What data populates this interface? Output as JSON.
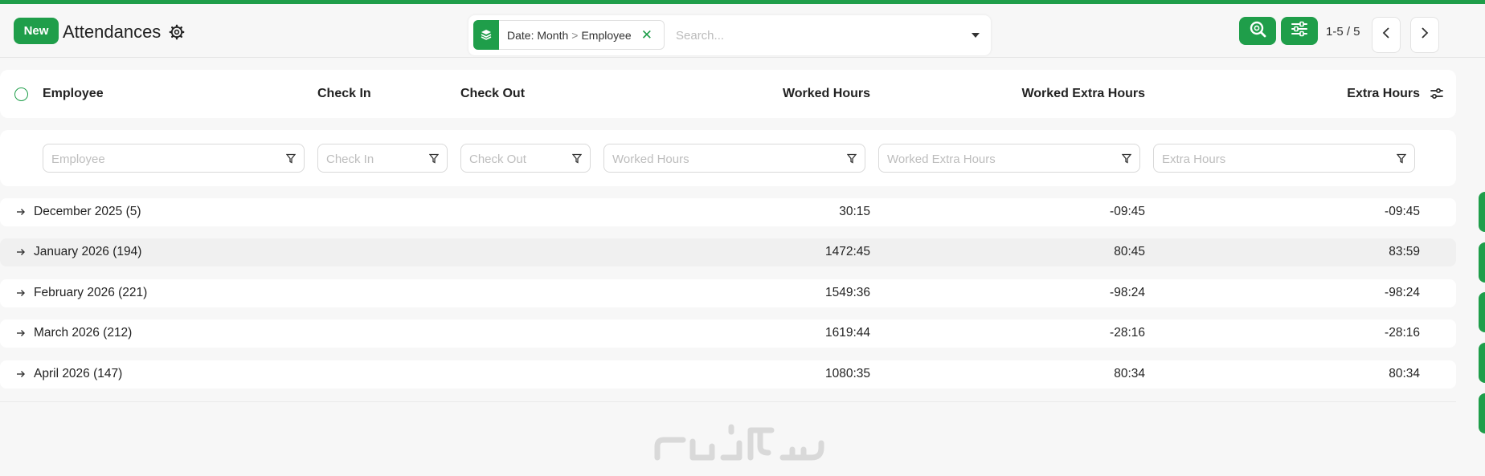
{
  "app": {
    "accent_color": "#1f9e4a",
    "new_label": "New",
    "title": "Attendances"
  },
  "search": {
    "facet_field": "Date: Month",
    "facet_separator": ">",
    "facet_value": "Employee",
    "placeholder": "Search...",
    "value": ""
  },
  "pager": {
    "text": "1-5 / 5"
  },
  "icons": {
    "gear": "gear-icon",
    "facet": "layers-icon",
    "search_panel": "search-zoom-icon",
    "filters_panel": "sliders-icon",
    "prev": "chevron-left-icon",
    "next": "chevron-right-icon",
    "column_options": "column-settings-icon",
    "group_expand": "arrow-right-icon",
    "filter": "funnel-icon"
  },
  "table": {
    "headers": {
      "employee": "Employee",
      "check_in": "Check In",
      "check_out": "Check Out",
      "worked_hours": "Worked Hours",
      "worked_extra_hours": "Worked Extra Hours",
      "extra_hours": "Extra Hours"
    },
    "filters": {
      "employee": "Employee",
      "check_in": "Check In",
      "check_out": "Check Out",
      "worked_hours": "Worked Hours",
      "worked_extra_hours": "Worked Extra Hours",
      "extra_hours": "Extra Hours"
    },
    "groups": [
      {
        "label": "December 2025 (5)",
        "worked_hours": "30:15",
        "worked_extra_hours": "-09:45",
        "extra_hours": "-09:45"
      },
      {
        "label": "January 2026 (194)",
        "worked_hours": "1472:45",
        "worked_extra_hours": "80:45",
        "extra_hours": "83:59"
      },
      {
        "label": "February 2026 (221)",
        "worked_hours": "1549:36",
        "worked_extra_hours": "-98:24",
        "extra_hours": "-98:24"
      },
      {
        "label": "March 2026 (212)",
        "worked_hours": "1619:44",
        "worked_extra_hours": "-28:16",
        "extra_hours": "-28:16"
      },
      {
        "label": "April 2026 (147)",
        "worked_hours": "1080:35",
        "worked_extra_hours": "80:34",
        "extra_hours": "80:34"
      }
    ]
  }
}
